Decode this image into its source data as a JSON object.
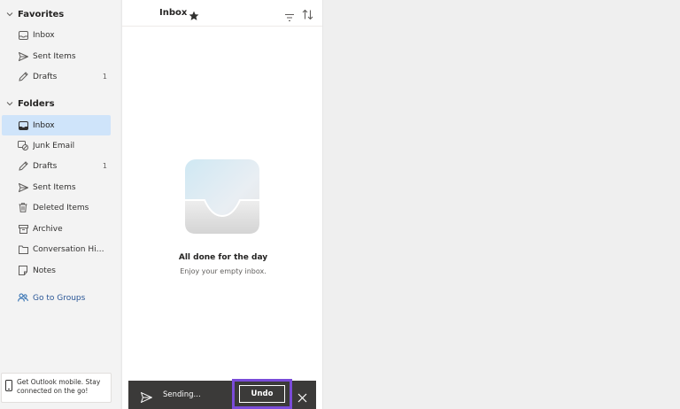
{
  "sidebar": {
    "favorites": {
      "label": "Favorites",
      "items": [
        {
          "label": "Inbox",
          "icon": "inbox-icon",
          "count": ""
        },
        {
          "label": "Sent Items",
          "icon": "send-icon",
          "count": ""
        },
        {
          "label": "Drafts",
          "icon": "pencil-icon",
          "count": "1"
        }
      ]
    },
    "folders": {
      "label": "Folders",
      "items": [
        {
          "label": "Inbox",
          "icon": "inbox-icon",
          "count": "",
          "selected": true
        },
        {
          "label": "Junk Email",
          "icon": "junk-icon",
          "count": ""
        },
        {
          "label": "Drafts",
          "icon": "pencil-icon",
          "count": "1"
        },
        {
          "label": "Sent Items",
          "icon": "send-icon",
          "count": ""
        },
        {
          "label": "Deleted Items",
          "icon": "trash-icon",
          "count": ""
        },
        {
          "label": "Archive",
          "icon": "archive-icon",
          "count": ""
        },
        {
          "label": "Conversation Histo...",
          "icon": "folder-icon",
          "count": ""
        },
        {
          "label": "Notes",
          "icon": "notes-icon",
          "count": ""
        }
      ]
    },
    "groups_link": {
      "label": "Go to Groups",
      "icon": "groups-icon"
    },
    "promo": {
      "text": "Get Outlook mobile. Stay connected on the go!",
      "icon": "phone-icon"
    }
  },
  "list": {
    "title": "Inbox",
    "empty_title": "All done for the day",
    "empty_subtitle": "Enjoy your empty inbox."
  },
  "snackbar": {
    "text": "Sending...",
    "undo_label": "Undo"
  },
  "colors": {
    "selected_bg": "#cfe4fa",
    "snackbar_bg": "#3b3a39",
    "highlight": "#7a4bd9"
  }
}
